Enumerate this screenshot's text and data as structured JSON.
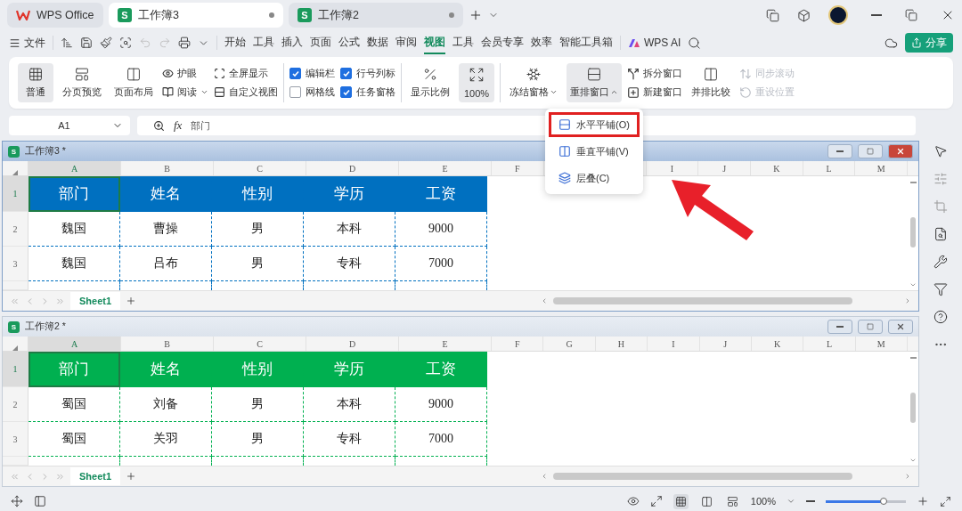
{
  "app_tabs": [
    {
      "label": "WPS Office",
      "kind": "home",
      "selected": false
    },
    {
      "label": "工作簿3",
      "kind": "doc",
      "icon_letter": "S",
      "selected": true
    },
    {
      "label": "工作簿2",
      "kind": "doc",
      "icon_letter": "S",
      "selected": false
    }
  ],
  "menu": {
    "file": "文件",
    "tabs": [
      {
        "label": "开始",
        "selected": false
      },
      {
        "label": "工具",
        "selected": false
      },
      {
        "label": "插入",
        "selected": false
      },
      {
        "label": "页面",
        "selected": false
      },
      {
        "label": "公式",
        "selected": false
      },
      {
        "label": "数据",
        "selected": false
      },
      {
        "label": "审阅",
        "selected": false
      },
      {
        "label": "视图",
        "selected": true
      },
      {
        "label": "工具",
        "selected": false
      },
      {
        "label": "会员专享",
        "selected": false
      },
      {
        "label": "效率",
        "selected": false
      },
      {
        "label": "智能工具箱",
        "selected": false
      }
    ],
    "ai": "WPS AI",
    "share": "分享"
  },
  "ribbon": {
    "views": [
      {
        "label": "普通",
        "selected": true
      },
      {
        "label": "分页预览",
        "selected": false
      },
      {
        "label": "页面布局",
        "selected": false
      }
    ],
    "view_tools": [
      {
        "label": "护眼",
        "dropdown": false
      },
      {
        "label": "阅读",
        "dropdown": true
      },
      {
        "label": "全屏显示",
        "dropdown": false
      },
      {
        "label": "自定义视图",
        "dropdown": false
      }
    ],
    "checks": [
      {
        "label": "编辑栏",
        "checked": true
      },
      {
        "label": "网格线",
        "checked": false
      },
      {
        "label": "行号列标",
        "checked": true
      },
      {
        "label": "任务窗格",
        "checked": true
      }
    ],
    "zoom": [
      {
        "label": "显示比例",
        "selected": false
      },
      {
        "label": "100%",
        "selected": true
      }
    ],
    "window_big": [
      {
        "label": "冻结窗格",
        "expanded": false
      },
      {
        "label": "重排窗口",
        "expanded": true
      }
    ],
    "window_small": [
      {
        "label": "拆分窗口",
        "disabled": false
      },
      {
        "label": "新建窗口",
        "disabled": false
      }
    ],
    "compare": "并排比较",
    "sync": [
      {
        "label": "同步滚动",
        "disabled": true
      },
      {
        "label": "重设位置",
        "disabled": true
      }
    ]
  },
  "formula_bar": {
    "cell": "A1",
    "fx": "fx",
    "value": "部门"
  },
  "arrange_menu": [
    {
      "label": "水平平铺(O)",
      "selected": true
    },
    {
      "label": "垂直平铺(V)",
      "selected": false
    },
    {
      "label": "层叠(C)",
      "selected": false
    }
  ],
  "workbooks": [
    {
      "title": "工作簿3 *",
      "icon_letter": "S",
      "active": true,
      "color": "#0070c0",
      "sheet_tab": "Sheet1",
      "columns": [
        {
          "label": "A",
          "selected": true
        },
        {
          "label": "B",
          "selected": false
        },
        {
          "label": "C",
          "selected": false
        },
        {
          "label": "D",
          "selected": false
        },
        {
          "label": "E",
          "selected": false
        },
        {
          "label": "F",
          "selected": false
        },
        {
          "label": "I",
          "selected": false
        },
        {
          "label": "J",
          "selected": false
        },
        {
          "label": "K",
          "selected": false
        },
        {
          "label": "L",
          "selected": false
        },
        {
          "label": "M",
          "selected": false
        }
      ],
      "rows": [
        {
          "number": "1",
          "selected": true,
          "cells": [
            "部门",
            "姓名",
            "性别",
            "学历",
            "工资"
          ]
        },
        {
          "number": "2",
          "selected": false,
          "cells": [
            "魏国",
            "曹操",
            "男",
            "本科",
            "9000"
          ]
        },
        {
          "number": "3",
          "selected": false,
          "cells": [
            "魏国",
            "吕布",
            "男",
            "专科",
            "7000"
          ]
        }
      ]
    },
    {
      "title": "工作簿2 *",
      "icon_letter": "S",
      "active": false,
      "color": "#00b050",
      "sheet_tab": "Sheet1",
      "columns": [
        {
          "label": "A",
          "selected": true
        },
        {
          "label": "B",
          "selected": false
        },
        {
          "label": "C",
          "selected": false
        },
        {
          "label": "D",
          "selected": false
        },
        {
          "label": "E",
          "selected": false
        },
        {
          "label": "F",
          "selected": false
        },
        {
          "label": "G",
          "selected": false
        },
        {
          "label": "H",
          "selected": false
        },
        {
          "label": "I",
          "selected": false
        },
        {
          "label": "J",
          "selected": false
        },
        {
          "label": "K",
          "selected": false
        },
        {
          "label": "L",
          "selected": false
        },
        {
          "label": "M",
          "selected": false
        }
      ],
      "rows": [
        {
          "number": "1",
          "selected": true,
          "cells": [
            "部门",
            "姓名",
            "性别",
            "学历",
            "工资"
          ]
        },
        {
          "number": "2",
          "selected": false,
          "cells": [
            "蜀国",
            "刘备",
            "男",
            "本科",
            "9000"
          ]
        },
        {
          "number": "3",
          "selected": false,
          "cells": [
            "蜀国",
            "关羽",
            "男",
            "专科",
            "7000"
          ]
        }
      ]
    }
  ],
  "status_bar": {
    "zoom": "100%",
    "views": [
      {
        "selected": true
      },
      {
        "selected": false
      },
      {
        "selected": false
      }
    ],
    "zoom_slider": {
      "level": 0.72
    }
  }
}
